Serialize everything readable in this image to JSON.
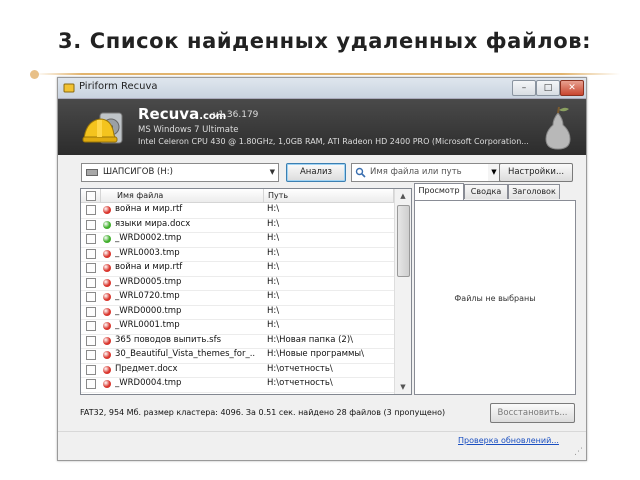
{
  "slide": {
    "title": "3. Список найденных удаленных файлов:"
  },
  "window": {
    "title": "Piriform Recuva",
    "min_label": "–",
    "max_label": "□",
    "close_label": "✕"
  },
  "header": {
    "app_name": "Recuva",
    "app_suffix": ".com",
    "version": "v1.36.179",
    "os": "MS Windows 7 Ultimate",
    "hardware": "Intel Celeron CPU 430 @ 1.80GHz, 1,0GB RAM, ATI Radeon HD 2400 PRO (Microsoft Corporation..."
  },
  "toolbar": {
    "drive": "ШАПСИГОВ (H:)",
    "analyze_label": "Анализ",
    "search_placeholder": "Имя файла или путь",
    "options_label": "Настройки..."
  },
  "filelist": {
    "columns": [
      "Имя файла",
      "Путь"
    ],
    "rows": [
      {
        "name": "война и мир.rtf",
        "path": "H:\\",
        "state": "red"
      },
      {
        "name": "языки мира.docx",
        "path": "H:\\",
        "state": "green"
      },
      {
        "name": "_WRD0002.tmp",
        "path": "H:\\",
        "state": "green"
      },
      {
        "name": "_WRL0003.tmp",
        "path": "H:\\",
        "state": "red"
      },
      {
        "name": "война и мир.rtf",
        "path": "H:\\",
        "state": "red"
      },
      {
        "name": "_WRD0005.tmp",
        "path": "H:\\",
        "state": "red"
      },
      {
        "name": "_WRL0720.tmp",
        "path": "H:\\",
        "state": "red"
      },
      {
        "name": "_WRD0000.tmp",
        "path": "H:\\",
        "state": "red"
      },
      {
        "name": "_WRL0001.tmp",
        "path": "H:\\",
        "state": "red"
      },
      {
        "name": "365 поводов выпить.sfs",
        "path": "H:\\Новая папка (2)\\",
        "state": "red"
      },
      {
        "name": "30_Beautiful_Vista_themes_for_...",
        "path": "H:\\Новые программы\\",
        "state": "red"
      },
      {
        "name": "Предмет.docx",
        "path": "H:\\отчетность\\",
        "state": "red"
      },
      {
        "name": "_WRD0004.tmp",
        "path": "H:\\отчетность\\",
        "state": "red"
      }
    ]
  },
  "tabs": [
    "Просмотр",
    "Сводка",
    "Заголовок"
  ],
  "preview": {
    "message": "Файлы не выбраны"
  },
  "status": {
    "text": "FAT32, 954 Мб. размер кластера: 4096. За 0.51 сек. найдено 28 файлов (3 пропущено)",
    "recover_label": "Восстановить...",
    "update_link": "Проверка обновлений..."
  },
  "colors": {
    "state_red": "#d9342b",
    "state_green": "#3fae2a",
    "header_bg": "#333333",
    "accent_line": "#e2b46e"
  }
}
